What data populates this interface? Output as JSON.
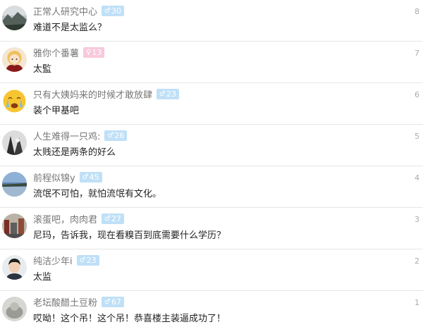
{
  "comments": [
    {
      "name": "正常人研究中心",
      "gender": "♂",
      "level": "30",
      "text": "难道不是太监么？",
      "floor": "8",
      "avatar": "landscape-avatar"
    },
    {
      "name": "雅你个番薯",
      "gender": "♀",
      "level": "13",
      "text": "太監",
      "floor": "7",
      "avatar": "anime-character-avatar"
    },
    {
      "name": "只有大姨妈来的时候才敢放肆",
      "gender": "♂",
      "level": "23",
      "text": "装个甲基吧",
      "floor": "6",
      "avatar": "crying-emoji-avatar"
    },
    {
      "name": "人生难得一只鸡:",
      "gender": "♂",
      "level": "26",
      "text": "太贱还是两条的好么",
      "floor": "5",
      "avatar": "dark-photo-avatar"
    },
    {
      "name": "前程似锦y",
      "gender": "♂",
      "level": "45",
      "text": "流氓不可怕，就怕流氓有文化。",
      "floor": "4",
      "avatar": "lake-scenery-avatar"
    },
    {
      "name": "滚蛋吧，肉肉君",
      "gender": "♂",
      "level": "27",
      "text": "尼玛，告诉我，现在看糗百到底需要什么学历？",
      "floor": "3",
      "avatar": "city-photo-avatar"
    },
    {
      "name": "纯洁少年i",
      "gender": "♂",
      "level": "23",
      "text": "太监",
      "floor": "2",
      "avatar": "boy-portrait-avatar"
    },
    {
      "name": "老坛酸醋土豆粉",
      "gender": "♂",
      "level": "67",
      "text": "哎呦！这个吊！这个吊！恭喜楼主装逼成功了！",
      "floor": "1",
      "avatar": "grey-photo-avatar"
    }
  ],
  "colors": {
    "male_badge": "#bfe0f7",
    "female_badge": "#f9c8dc",
    "divider": "#e6e6e6"
  }
}
